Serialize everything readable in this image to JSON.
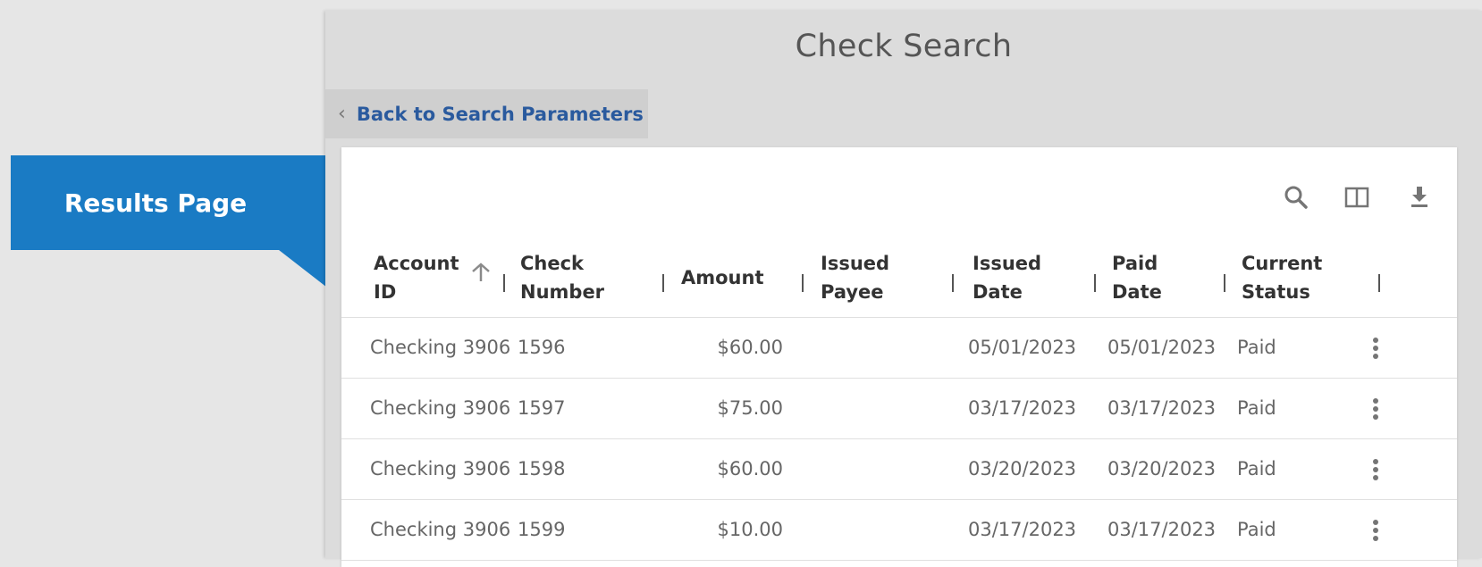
{
  "callout": {
    "label": "Results Page"
  },
  "page": {
    "title": "Check Search",
    "back_link": "Back to Search Parameters"
  },
  "toolbar": {
    "icons": [
      "search-icon",
      "columns-icon",
      "download-icon"
    ]
  },
  "table": {
    "columns": [
      {
        "line1": "Account",
        "line2": "ID"
      },
      {
        "line1": "Check",
        "line2": "Number"
      },
      {
        "line1": "Amount",
        "line2": ""
      },
      {
        "line1": "Issued",
        "line2": "Payee"
      },
      {
        "line1": "Issued",
        "line2": "Date"
      },
      {
        "line1": "Paid",
        "line2": "Date"
      },
      {
        "line1": "Current",
        "line2": "Status"
      }
    ],
    "sort": {
      "column": "Account ID",
      "direction": "ascending"
    },
    "rows": [
      {
        "account": "Checking 3906",
        "check": "1596",
        "amount": "$60.00",
        "payee": "",
        "issued": "05/01/2023",
        "paid": "05/01/2023",
        "status": "Paid"
      },
      {
        "account": "Checking 3906",
        "check": "1597",
        "amount": "$75.00",
        "payee": "",
        "issued": "03/17/2023",
        "paid": "03/17/2023",
        "status": "Paid"
      },
      {
        "account": "Checking 3906",
        "check": "1598",
        "amount": "$60.00",
        "payee": "",
        "issued": "03/20/2023",
        "paid": "03/20/2023",
        "status": "Paid"
      },
      {
        "account": "Checking 3906",
        "check": "1599",
        "amount": "$10.00",
        "payee": "",
        "issued": "03/17/2023",
        "paid": "03/17/2023",
        "status": "Paid"
      }
    ]
  },
  "colors": {
    "callout": "#1a7bc4",
    "link": "#2a5a9e",
    "background": "#e6e6e6"
  }
}
